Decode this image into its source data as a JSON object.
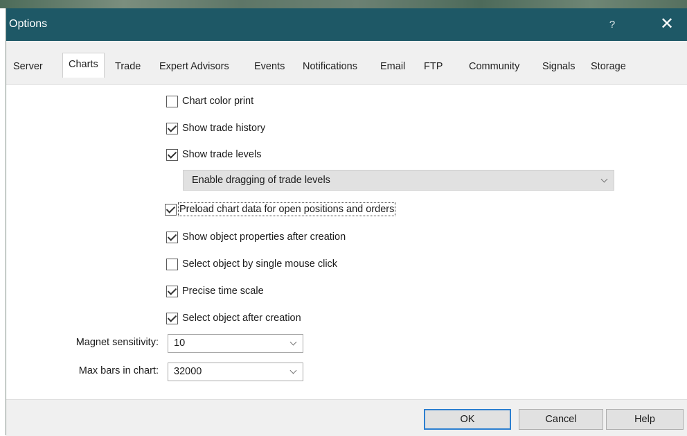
{
  "window": {
    "title": "Options",
    "help_glyph": "?",
    "close_glyph": "✕"
  },
  "tabs": [
    {
      "label": "Server"
    },
    {
      "label": "Charts",
      "active": true
    },
    {
      "label": "Trade"
    },
    {
      "label": "Expert Advisors"
    },
    {
      "label": "Events"
    },
    {
      "label": "Notifications"
    },
    {
      "label": "Email"
    },
    {
      "label": "FTP"
    },
    {
      "label": "Community"
    },
    {
      "label": "Signals"
    },
    {
      "label": "Storage"
    }
  ],
  "charts": {
    "chart_color_print": {
      "label": "Chart color print",
      "checked": false
    },
    "show_trade_history": {
      "label": "Show trade history",
      "checked": true
    },
    "show_trade_levels": {
      "label": "Show trade levels",
      "checked": true
    },
    "trade_levels_mode": {
      "value": "Enable dragging of trade levels"
    },
    "preload_chart_data": {
      "label": "Preload chart data for open positions and orders",
      "checked": true
    },
    "show_object_properties": {
      "label": "Show object properties after creation",
      "checked": true
    },
    "select_single_click": {
      "label": "Select object by single mouse click",
      "checked": false
    },
    "precise_time_scale": {
      "label": "Precise time scale",
      "checked": true
    },
    "select_after_creation": {
      "label": "Select object after creation",
      "checked": true
    },
    "magnet_sensitivity": {
      "label": "Magnet sensitivity:",
      "value": "10"
    },
    "max_bars": {
      "label": "Max bars in chart:",
      "value": "32000"
    }
  },
  "buttons": {
    "ok": "OK",
    "cancel": "Cancel",
    "help": "Help"
  },
  "colors": {
    "titlebar": "#1e5866",
    "default_button_border": "#2c7fd0"
  }
}
